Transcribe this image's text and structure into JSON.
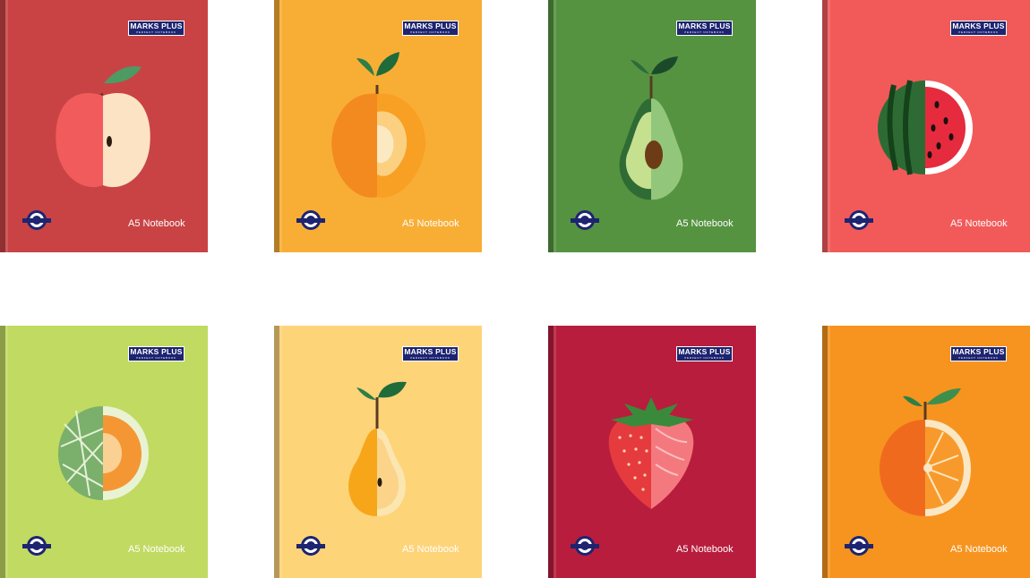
{
  "notebooks": [
    {
      "fruit": "apple",
      "brand": "MARKS PLUS",
      "tagline": "PERFECT NOTEBOOK",
      "label": "A5 Notebook",
      "cover_color": "#c94345",
      "badge_text": "PREMIUM QUALITY"
    },
    {
      "fruit": "mango",
      "brand": "MARKS PLUS",
      "tagline": "PERFECT NOTEBOOK",
      "label": "A5 Notebook",
      "cover_color": "#f8ae35",
      "badge_text": "PREMIUM QUALITY"
    },
    {
      "fruit": "avocado",
      "brand": "MARKS PLUS",
      "tagline": "PERFECT NOTEBOOK",
      "label": "A5 Notebook",
      "cover_color": "#559340",
      "badge_text": "PREMIUM QUALITY"
    },
    {
      "fruit": "watermelon",
      "brand": "MARKS PLUS",
      "tagline": "PERFECT NOTEBOOK",
      "label": "A5 Notebook",
      "cover_color": "#f25a5a",
      "badge_text": "PREMIUM QUALITY"
    },
    {
      "fruit": "melon",
      "brand": "MARKS PLUS",
      "tagline": "PERFECT NOTEBOOK",
      "label": "A5 Notebook",
      "cover_color": "#c1da62",
      "badge_text": "PREMIUM QUALITY"
    },
    {
      "fruit": "pear",
      "brand": "MARKS PLUS",
      "tagline": "PERFECT NOTEBOOK",
      "label": "A5 Notebook",
      "cover_color": "#fed479",
      "badge_text": "PREMIUM QUALITY"
    },
    {
      "fruit": "strawberry",
      "brand": "MARKS PLUS",
      "tagline": "PERFECT NOTEBOOK",
      "label": "A5 Notebook",
      "cover_color": "#b81d3d",
      "badge_text": "PREMIUM QUALITY"
    },
    {
      "fruit": "orange",
      "brand": "MARKS PLUS",
      "tagline": "PERFECT NOTEBOOK",
      "label": "A5 Notebook",
      "cover_color": "#f7941f",
      "badge_text": "PREMIUM QUALITY"
    }
  ]
}
